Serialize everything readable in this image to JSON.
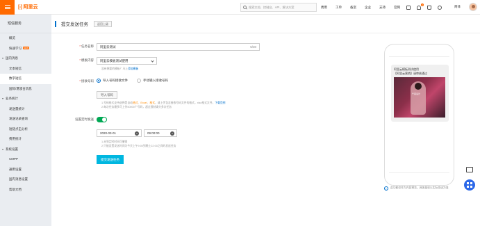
{
  "topbar": {
    "brand": "阿里云",
    "search_placeholder": "搜索文档、控制台、API、解决方案",
    "nav": [
      "费用",
      "工单",
      "备案",
      "企业",
      "支持",
      "官网"
    ],
    "icons": [
      "screen-icon",
      "bell-icon",
      "cart-icon",
      "help-icon"
    ],
    "notification_count": "1",
    "user_label": "简体"
  },
  "sidebar": {
    "title": "短信服务",
    "items": [
      {
        "label": "概览",
        "type": "item",
        "name": "overview"
      },
      {
        "label": "快速学习",
        "type": "item",
        "badge": "NEW",
        "name": "quick-learn"
      },
      {
        "label": "国内消息",
        "type": "group",
        "name": "domestic-messages"
      },
      {
        "label": "文本短信",
        "type": "sub",
        "name": "text-sms"
      },
      {
        "label": "数字短信",
        "type": "sub",
        "active": true,
        "name": "digital-sms"
      },
      {
        "label": "国际/港澳台消息",
        "type": "item",
        "name": "international-messages"
      },
      {
        "label": "业务统计",
        "type": "group",
        "name": "business-stats"
      },
      {
        "label": "发送量统计",
        "type": "sub",
        "name": "send-volume-stats"
      },
      {
        "label": "发送记录查询",
        "type": "sub",
        "name": "send-record-query"
      },
      {
        "label": "短链点击分析",
        "type": "sub",
        "name": "short-link-analysis"
      },
      {
        "label": "费用统计",
        "type": "sub",
        "name": "cost-stats"
      },
      {
        "label": "系统设置",
        "type": "group",
        "name": "system-settings"
      },
      {
        "label": "CMPP",
        "type": "sub",
        "name": "cmpp"
      },
      {
        "label": "通用设置",
        "type": "sub",
        "name": "general-settings"
      },
      {
        "label": "国内消息设置",
        "type": "sub",
        "name": "domestic-settings"
      },
      {
        "label": "帮助文档",
        "type": "item",
        "name": "help-docs"
      }
    ]
  },
  "page": {
    "title": "提交发送任务",
    "back_label": "返回上级"
  },
  "form": {
    "task_name": {
      "label": "任务名称",
      "value": "阿里云测试",
      "count": "5/30"
    },
    "template": {
      "label": "模板内容",
      "value": "阿里云模板测试使用",
      "hint": "没有想要的模板？马上",
      "hint_link": "添加模板"
    },
    "receiver": {
      "label": "接收号码",
      "option_import": "导入号码接收文件",
      "option_manual": "手动输入接收号码",
      "import_button": "导入号码",
      "hint1_pre": "1.号码格式支持选择是自动",
      "hint1_a": "格式",
      "hint1_mid": "、",
      "hint1_b": "Excel",
      "hint1_c": "、",
      "hint1_d": "格式",
      "hint1_post": "，请上传包含接收号码文件的格式，xlsx格式文件，",
      "hint1_link": "下载范例",
      "hint2": "2.每次任务最多可上传50000个号码，超过限制请分多次任务"
    },
    "schedule": {
      "label": "设置定时发送",
      "date": "2020-03-01",
      "time": "09:00:00",
      "hint1": "1.未到定时时间可撤销",
      "hint2": "2.只能设置发送时间为今天上午9:00到晚上22:00之间的发送任务"
    },
    "submit_label": "提交发送任务"
  },
  "preview": {
    "message": "阿里云模板测试使用\n【阿里云营销】请审核通过",
    "image_label": "千度设计",
    "note": "此功能仅作为内容预览，具体展现以实际发送为准"
  },
  "colors": {
    "accent": "#ff6a00",
    "primary": "#00b7e0",
    "link": "#0070cc",
    "toggle_on": "#00a854"
  }
}
